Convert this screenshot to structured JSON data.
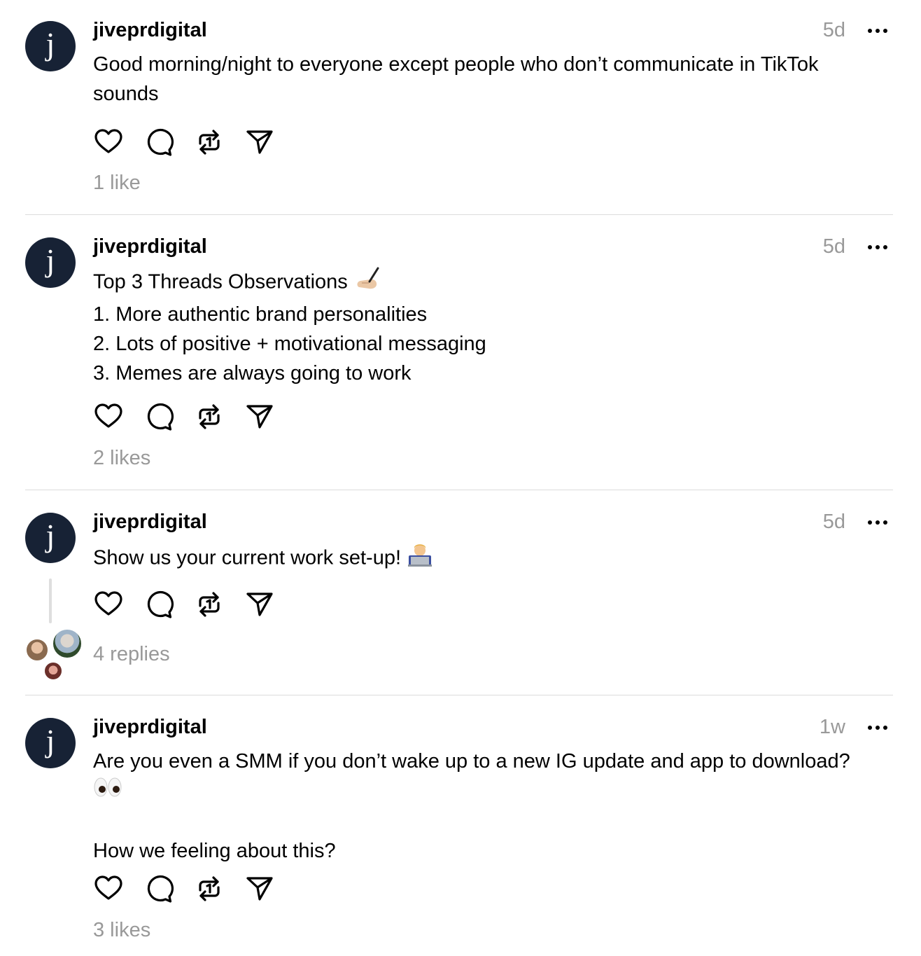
{
  "posts": [
    {
      "username": "jiveprdigital",
      "avatar_letter": "j",
      "time": "5d",
      "lines": [
        "Good morning/night to everyone except people who don’t communicate in TikTok",
        "sounds"
      ],
      "meta": "1 like"
    },
    {
      "username": "jiveprdigital",
      "avatar_letter": "j",
      "time": "5d",
      "lines": [
        "Top 3 Threads Observations",
        "1. More authentic brand personalities",
        "2. Lots of positive + motivational messaging",
        "3. Memes are always going to work"
      ],
      "line_emoji": "writing-hand-emoji",
      "meta": "2 likes"
    },
    {
      "username": "jiveprdigital",
      "avatar_letter": "j",
      "time": "5d",
      "lines": [
        "Show us your current work set-up!"
      ],
      "line_emoji": "technologist-emoji",
      "meta": "4 replies"
    },
    {
      "username": "jiveprdigital",
      "avatar_letter": "j",
      "time": "1w",
      "lines": [
        "Are you even a SMM if you don’t wake up to a new IG update and app to download?",
        "",
        "",
        "How we feeling about this?"
      ],
      "line_emoji": "eyes-emoji",
      "meta": "3 likes"
    }
  ],
  "icons": [
    "heart-icon",
    "comment-icon",
    "repost-icon",
    "share-icon",
    "more-icon"
  ],
  "colors": {
    "avatar_bg": "#172235",
    "muted_text": "#999999",
    "divider": "#dcdcdc"
  }
}
